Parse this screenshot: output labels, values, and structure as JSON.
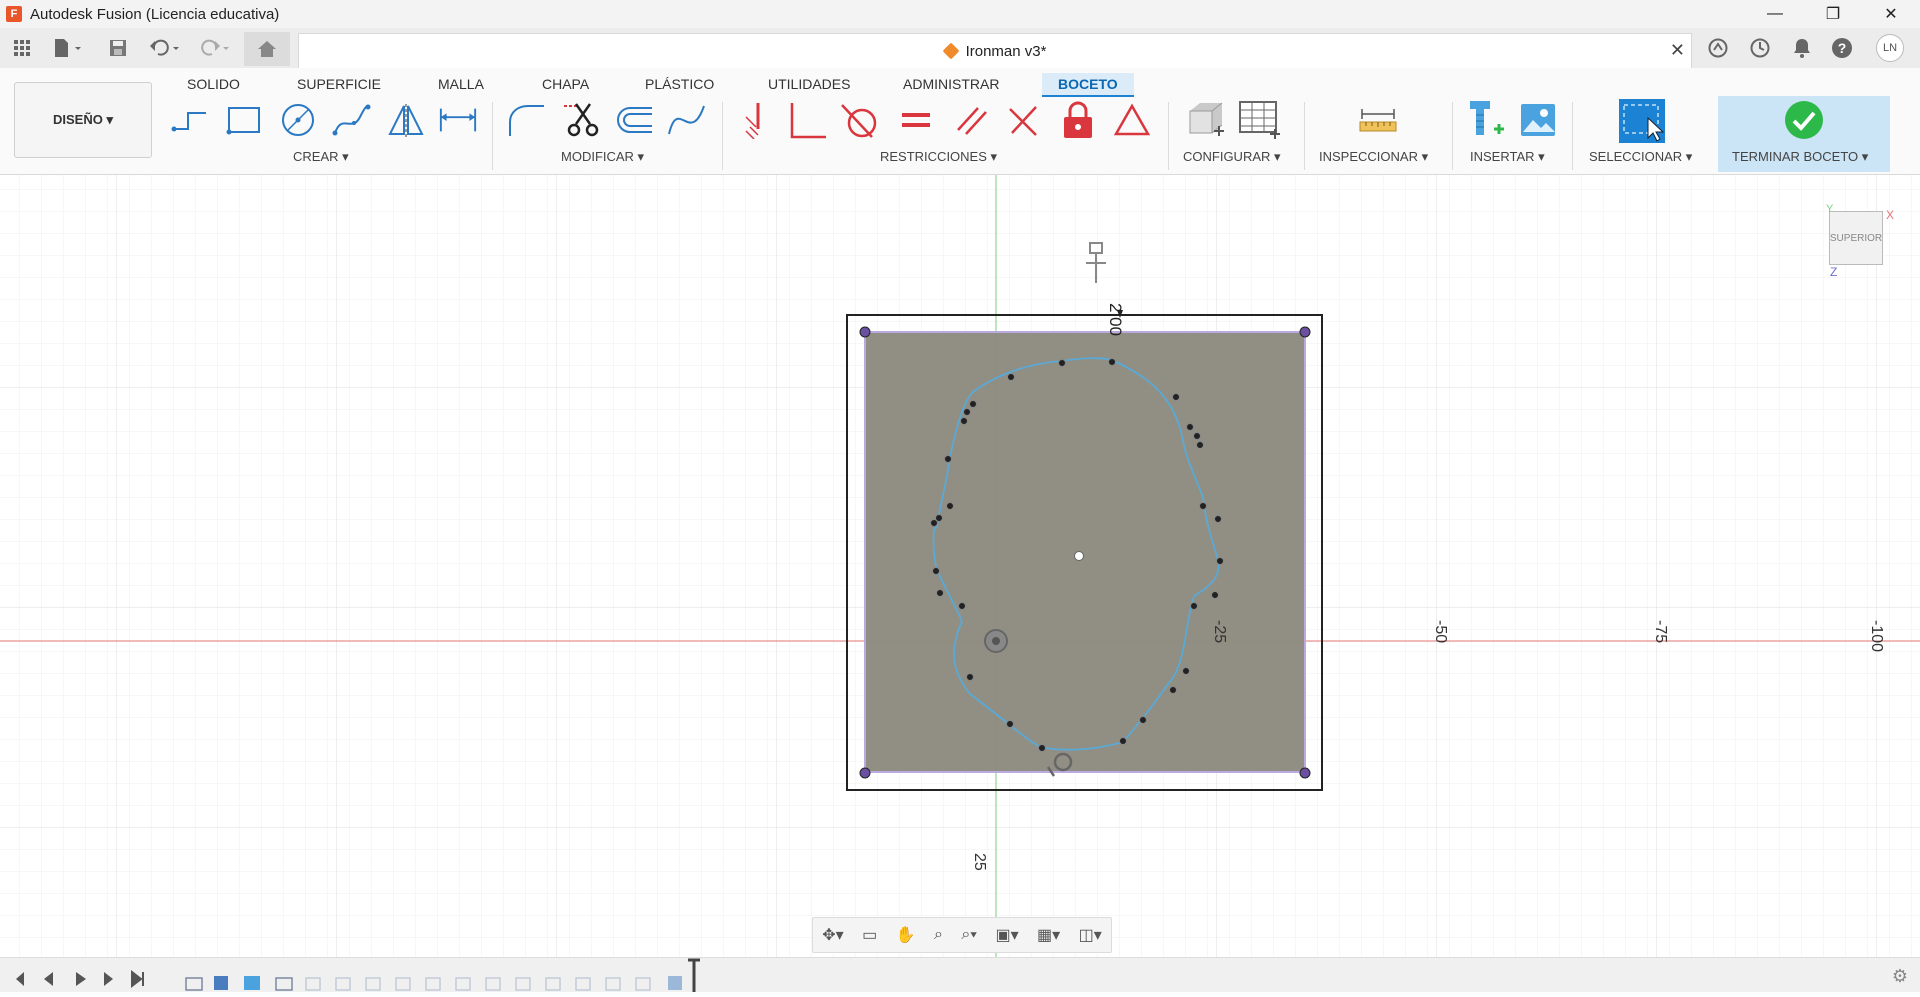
{
  "window": {
    "title": "Autodesk Fusion (Licencia educativa)",
    "logo_letter": "F",
    "minimize": "—",
    "maximize": "❐",
    "close": "✕"
  },
  "document": {
    "name": "Ironman v3*",
    "close": "✕"
  },
  "quick_access": {
    "user_initials": "LN",
    "help": "?"
  },
  "workspace": {
    "label": "DISEÑO ▾"
  },
  "ribbon_tabs": [
    {
      "label": "SOLIDO"
    },
    {
      "label": "SUPERFICIE"
    },
    {
      "label": "MALLA"
    },
    {
      "label": "CHAPA"
    },
    {
      "label": "PLÁSTICO"
    },
    {
      "label": "UTILIDADES"
    },
    {
      "label": "ADMINISTRAR"
    },
    {
      "label": "BOCETO"
    }
  ],
  "groups": {
    "crear": "CREAR ▾",
    "modificar": "MODIFICAR ▾",
    "restricciones": "RESTRICCIONES ▾",
    "configurar": "CONFIGURAR ▾",
    "inspeccionar": "INSPECCIONAR ▾",
    "insertar": "INSERTAR ▾",
    "seleccionar": "SELECCIONAR ▾",
    "terminar": "TERMINAR BOCETO ▾"
  },
  "viewcube": {
    "face": "SUPERIOR",
    "axis_x": "X",
    "axis_y": "Y",
    "axis_z": "Z"
  },
  "canvas": {
    "dimension_label": "2.00",
    "axis_labels": [
      "-25",
      "-50",
      "-75",
      "-100",
      "25"
    ]
  },
  "colors": {
    "accent": "#1c83d4",
    "finish_green": "#2db84a",
    "constraint_red": "#d9363e",
    "spline": "#5aa9d6",
    "image_fill": "#8e8c80",
    "grid": "#e6e6e6",
    "axis_red": "#e57373",
    "axis_green": "#7ccd7c"
  }
}
